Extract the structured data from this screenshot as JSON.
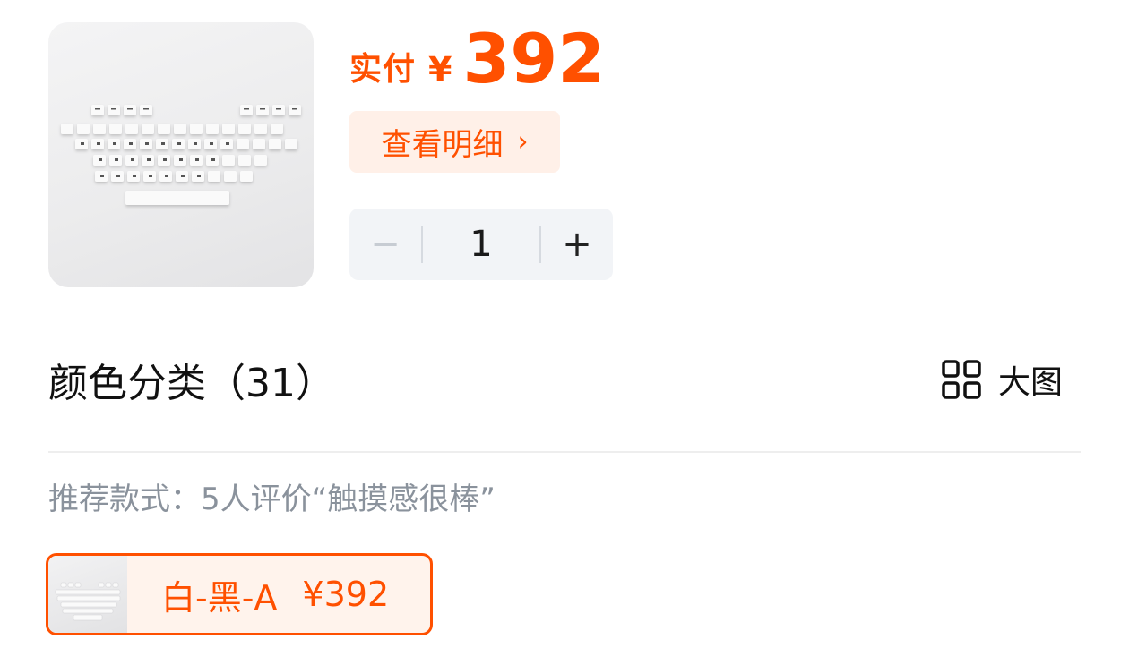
{
  "product": {
    "image_icon": "keyboard-keycaps-image"
  },
  "price": {
    "label": "实付",
    "currency": "¥",
    "value": "392",
    "color": "#ff5000"
  },
  "detail_button": {
    "label": "查看明细",
    "chevron": "›"
  },
  "stepper": {
    "minus": "−",
    "quantity": "1",
    "plus": "+"
  },
  "color_section": {
    "title": "颜色分类（31）",
    "big_view_label": "大图",
    "big_view_icon": "grid-icon"
  },
  "recommend": {
    "text": "推荐款式：5人评价“触摸感很棒”"
  },
  "variants": [
    {
      "name": "白-黑-A",
      "price": "¥392",
      "selected": true
    }
  ]
}
